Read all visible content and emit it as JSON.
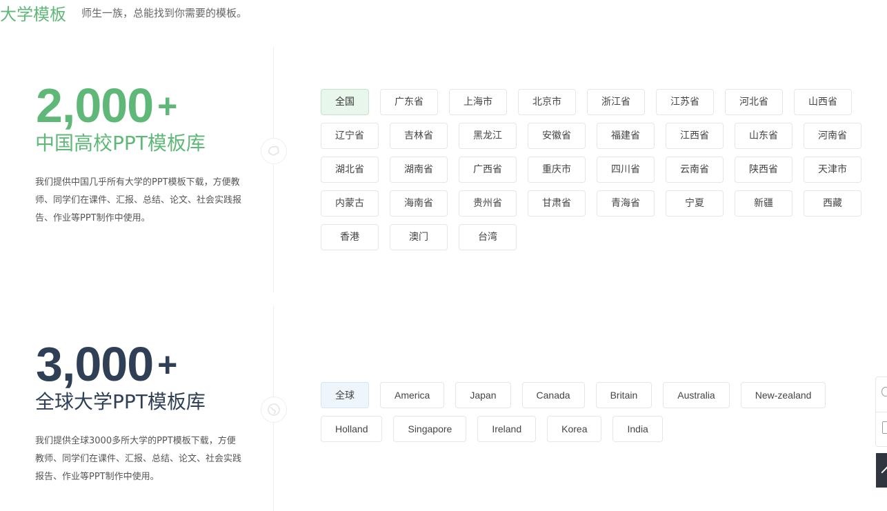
{
  "header": {
    "title": "大学模板",
    "subtitle": "师生一族，总能找到你需要的模板。"
  },
  "china": {
    "number": "2,000",
    "plus": "+",
    "title": "中国高校PPT模板库",
    "description": "我们提供中国几乎所有大学的PPT模板下载，方便教师、同学们在课件、汇报、总结、论文、社会实践报告、作业等PPT制作中使用。",
    "icon": "china-map-icon",
    "regions": [
      "全国",
      "广东省",
      "上海市",
      "北京市",
      "浙江省",
      "江苏省",
      "河北省",
      "山西省",
      "辽宁省",
      "吉林省",
      "黑龙江",
      "安徽省",
      "福建省",
      "江西省",
      "山东省",
      "河南省",
      "湖北省",
      "湖南省",
      "广西省",
      "重庆市",
      "四川省",
      "云南省",
      "陕西省",
      "天津市",
      "内蒙古",
      "海南省",
      "贵州省",
      "甘肃省",
      "青海省",
      "宁夏",
      "新疆",
      "西藏",
      "香港",
      "澳门",
      "台湾"
    ]
  },
  "world": {
    "number": "3,000",
    "plus": "+",
    "title": "全球大学PPT模板库",
    "description": "我们提供全球3000多所大学的PPT模板下载，方便教师、同学们在课件、汇报、总结、论文、社会实践报告、作业等PPT制作中使用。",
    "icon": "globe-icon",
    "countries": [
      "全球",
      "America",
      "Japan",
      "Canada",
      "Britain",
      "Australia",
      "New-zealand",
      "Holland",
      "Singapore",
      "Ireland",
      "Korea",
      "India"
    ]
  },
  "colors": {
    "green": "#5fb878",
    "navy": "#2f4056"
  }
}
